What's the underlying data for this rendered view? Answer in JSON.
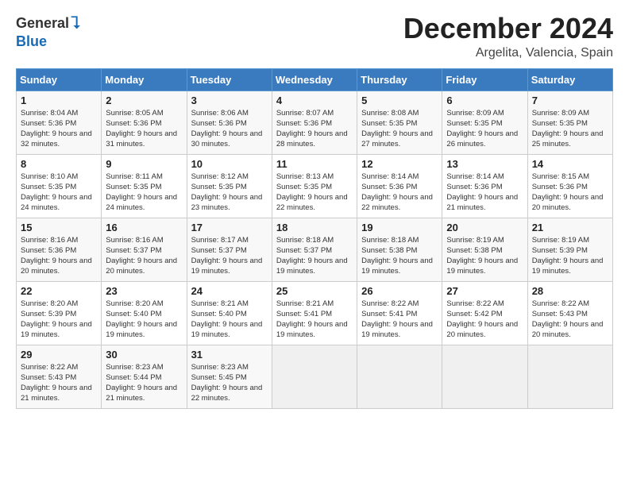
{
  "header": {
    "logo_general": "General",
    "logo_blue": "Blue",
    "month_title": "December 2024",
    "location": "Argelita, Valencia, Spain"
  },
  "weekdays": [
    "Sunday",
    "Monday",
    "Tuesday",
    "Wednesday",
    "Thursday",
    "Friday",
    "Saturday"
  ],
  "weeks": [
    [
      {
        "day": "1",
        "sunrise": "Sunrise: 8:04 AM",
        "sunset": "Sunset: 5:36 PM",
        "daylight": "Daylight: 9 hours and 32 minutes."
      },
      {
        "day": "2",
        "sunrise": "Sunrise: 8:05 AM",
        "sunset": "Sunset: 5:36 PM",
        "daylight": "Daylight: 9 hours and 31 minutes."
      },
      {
        "day": "3",
        "sunrise": "Sunrise: 8:06 AM",
        "sunset": "Sunset: 5:36 PM",
        "daylight": "Daylight: 9 hours and 30 minutes."
      },
      {
        "day": "4",
        "sunrise": "Sunrise: 8:07 AM",
        "sunset": "Sunset: 5:36 PM",
        "daylight": "Daylight: 9 hours and 28 minutes."
      },
      {
        "day": "5",
        "sunrise": "Sunrise: 8:08 AM",
        "sunset": "Sunset: 5:35 PM",
        "daylight": "Daylight: 9 hours and 27 minutes."
      },
      {
        "day": "6",
        "sunrise": "Sunrise: 8:09 AM",
        "sunset": "Sunset: 5:35 PM",
        "daylight": "Daylight: 9 hours and 26 minutes."
      },
      {
        "day": "7",
        "sunrise": "Sunrise: 8:09 AM",
        "sunset": "Sunset: 5:35 PM",
        "daylight": "Daylight: 9 hours and 25 minutes."
      }
    ],
    [
      {
        "day": "8",
        "sunrise": "Sunrise: 8:10 AM",
        "sunset": "Sunset: 5:35 PM",
        "daylight": "Daylight: 9 hours and 24 minutes."
      },
      {
        "day": "9",
        "sunrise": "Sunrise: 8:11 AM",
        "sunset": "Sunset: 5:35 PM",
        "daylight": "Daylight: 9 hours and 24 minutes."
      },
      {
        "day": "10",
        "sunrise": "Sunrise: 8:12 AM",
        "sunset": "Sunset: 5:35 PM",
        "daylight": "Daylight: 9 hours and 23 minutes."
      },
      {
        "day": "11",
        "sunrise": "Sunrise: 8:13 AM",
        "sunset": "Sunset: 5:35 PM",
        "daylight": "Daylight: 9 hours and 22 minutes."
      },
      {
        "day": "12",
        "sunrise": "Sunrise: 8:14 AM",
        "sunset": "Sunset: 5:36 PM",
        "daylight": "Daylight: 9 hours and 22 minutes."
      },
      {
        "day": "13",
        "sunrise": "Sunrise: 8:14 AM",
        "sunset": "Sunset: 5:36 PM",
        "daylight": "Daylight: 9 hours and 21 minutes."
      },
      {
        "day": "14",
        "sunrise": "Sunrise: 8:15 AM",
        "sunset": "Sunset: 5:36 PM",
        "daylight": "Daylight: 9 hours and 20 minutes."
      }
    ],
    [
      {
        "day": "15",
        "sunrise": "Sunrise: 8:16 AM",
        "sunset": "Sunset: 5:36 PM",
        "daylight": "Daylight: 9 hours and 20 minutes."
      },
      {
        "day": "16",
        "sunrise": "Sunrise: 8:16 AM",
        "sunset": "Sunset: 5:37 PM",
        "daylight": "Daylight: 9 hours and 20 minutes."
      },
      {
        "day": "17",
        "sunrise": "Sunrise: 8:17 AM",
        "sunset": "Sunset: 5:37 PM",
        "daylight": "Daylight: 9 hours and 19 minutes."
      },
      {
        "day": "18",
        "sunrise": "Sunrise: 8:18 AM",
        "sunset": "Sunset: 5:37 PM",
        "daylight": "Daylight: 9 hours and 19 minutes."
      },
      {
        "day": "19",
        "sunrise": "Sunrise: 8:18 AM",
        "sunset": "Sunset: 5:38 PM",
        "daylight": "Daylight: 9 hours and 19 minutes."
      },
      {
        "day": "20",
        "sunrise": "Sunrise: 8:19 AM",
        "sunset": "Sunset: 5:38 PM",
        "daylight": "Daylight: 9 hours and 19 minutes."
      },
      {
        "day": "21",
        "sunrise": "Sunrise: 8:19 AM",
        "sunset": "Sunset: 5:39 PM",
        "daylight": "Daylight: 9 hours and 19 minutes."
      }
    ],
    [
      {
        "day": "22",
        "sunrise": "Sunrise: 8:20 AM",
        "sunset": "Sunset: 5:39 PM",
        "daylight": "Daylight: 9 hours and 19 minutes."
      },
      {
        "day": "23",
        "sunrise": "Sunrise: 8:20 AM",
        "sunset": "Sunset: 5:40 PM",
        "daylight": "Daylight: 9 hours and 19 minutes."
      },
      {
        "day": "24",
        "sunrise": "Sunrise: 8:21 AM",
        "sunset": "Sunset: 5:40 PM",
        "daylight": "Daylight: 9 hours and 19 minutes."
      },
      {
        "day": "25",
        "sunrise": "Sunrise: 8:21 AM",
        "sunset": "Sunset: 5:41 PM",
        "daylight": "Daylight: 9 hours and 19 minutes."
      },
      {
        "day": "26",
        "sunrise": "Sunrise: 8:22 AM",
        "sunset": "Sunset: 5:41 PM",
        "daylight": "Daylight: 9 hours and 19 minutes."
      },
      {
        "day": "27",
        "sunrise": "Sunrise: 8:22 AM",
        "sunset": "Sunset: 5:42 PM",
        "daylight": "Daylight: 9 hours and 20 minutes."
      },
      {
        "day": "28",
        "sunrise": "Sunrise: 8:22 AM",
        "sunset": "Sunset: 5:43 PM",
        "daylight": "Daylight: 9 hours and 20 minutes."
      }
    ],
    [
      {
        "day": "29",
        "sunrise": "Sunrise: 8:22 AM",
        "sunset": "Sunset: 5:43 PM",
        "daylight": "Daylight: 9 hours and 21 minutes."
      },
      {
        "day": "30",
        "sunrise": "Sunrise: 8:23 AM",
        "sunset": "Sunset: 5:44 PM",
        "daylight": "Daylight: 9 hours and 21 minutes."
      },
      {
        "day": "31",
        "sunrise": "Sunrise: 8:23 AM",
        "sunset": "Sunset: 5:45 PM",
        "daylight": "Daylight: 9 hours and 22 minutes."
      },
      null,
      null,
      null,
      null
    ]
  ]
}
